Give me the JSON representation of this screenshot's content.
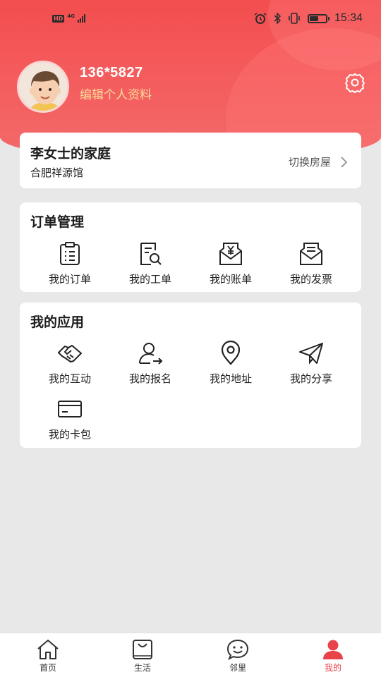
{
  "status_bar": {
    "time": "15:34",
    "network": "4G",
    "hd": "HD"
  },
  "profile": {
    "phone": "136*5827",
    "edit_label": "编辑个人资料"
  },
  "home": {
    "title": "李女士的家庭",
    "subtitle": "合肥祥源馆",
    "switch_label": "切换房屋"
  },
  "orders": {
    "title": "订单管理",
    "items": [
      {
        "label": "我的订单",
        "icon": "clipboard-icon"
      },
      {
        "label": "我的工单",
        "icon": "document-search-icon"
      },
      {
        "label": "我的账单",
        "icon": "yen-envelope-icon"
      },
      {
        "label": "我的发票",
        "icon": "invoice-envelope-icon"
      }
    ]
  },
  "apps": {
    "title": "我的应用",
    "items": [
      {
        "label": "我的互动",
        "icon": "handshake-icon"
      },
      {
        "label": "我的报名",
        "icon": "user-arrow-icon"
      },
      {
        "label": "我的地址",
        "icon": "location-pin-icon"
      },
      {
        "label": "我的分享",
        "icon": "paper-plane-icon"
      },
      {
        "label": "我的卡包",
        "icon": "card-icon"
      }
    ]
  },
  "tabbar": {
    "items": [
      {
        "label": "首页",
        "icon": "home-icon"
      },
      {
        "label": "生活",
        "icon": "shopping-bag-icon"
      },
      {
        "label": "邻里",
        "icon": "smile-icon"
      },
      {
        "label": "我的",
        "icon": "person-icon",
        "active": true
      }
    ]
  },
  "colors": {
    "header": "#f45e5f",
    "accent": "#e8434a",
    "edit_text": "#f9dd9a"
  }
}
